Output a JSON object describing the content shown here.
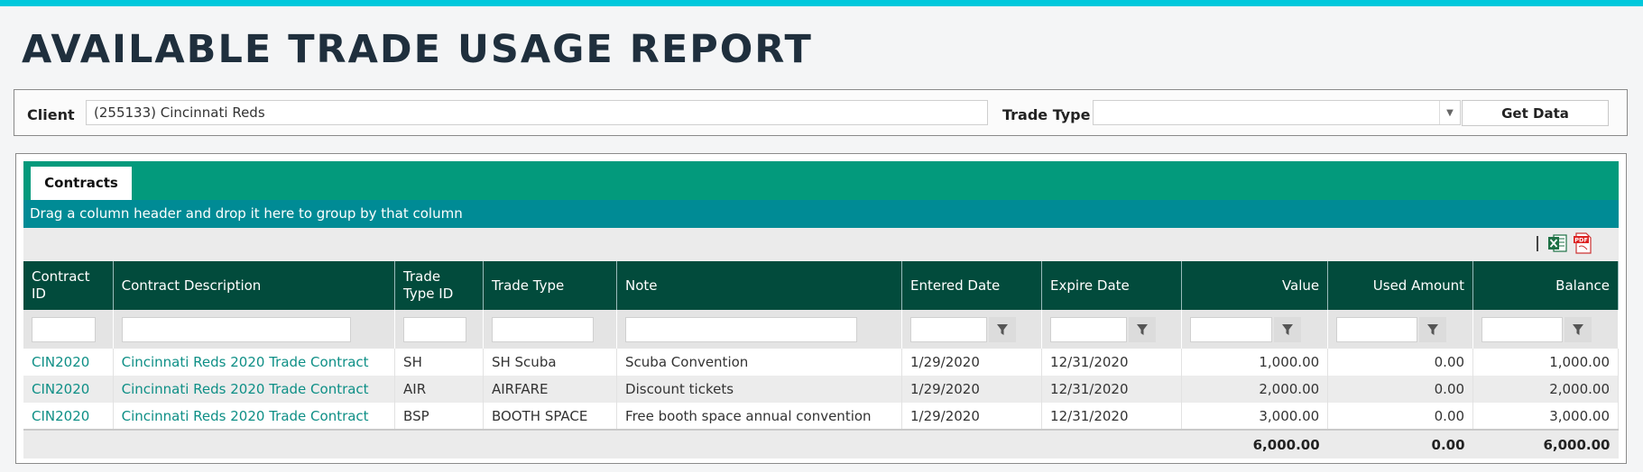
{
  "page_title": "AVAILABLE TRADE USAGE REPORT",
  "filters": {
    "client_label": "Client",
    "client_value": "(255133) Cincinnati Reds",
    "trade_type_label": "Trade Type",
    "trade_type_value": "",
    "get_data_label": "Get Data"
  },
  "tabs": [
    {
      "label": "Contracts",
      "active": true
    }
  ],
  "group_hint": "Drag a column header and drop it here to group by that column",
  "toolbar": {
    "export_excel_icon": "excel-icon",
    "export_pdf_icon": "pdf-icon"
  },
  "columns": [
    {
      "label": "Contract ID"
    },
    {
      "label": "Contract Description"
    },
    {
      "label": "Trade Type ID"
    },
    {
      "label": "Trade Type"
    },
    {
      "label": "Note"
    },
    {
      "label": "Entered Date"
    },
    {
      "label": "Expire Date"
    },
    {
      "label": "Value"
    },
    {
      "label": "Used Amount"
    },
    {
      "label": "Balance"
    }
  ],
  "rows": [
    {
      "contract_id": "CIN2020",
      "description": "Cincinnati Reds 2020 Trade Contract",
      "trade_type_id": "SH",
      "trade_type": "SH Scuba",
      "note": "Scuba Convention",
      "entered": "1/29/2020",
      "expire": "12/31/2020",
      "value": "1,000.00",
      "used": "0.00",
      "balance": "1,000.00"
    },
    {
      "contract_id": "CIN2020",
      "description": "Cincinnati Reds 2020 Trade Contract",
      "trade_type_id": "AIR",
      "trade_type": "AIRFARE",
      "note": "Discount tickets",
      "entered": "1/29/2020",
      "expire": "12/31/2020",
      "value": "2,000.00",
      "used": "0.00",
      "balance": "2,000.00"
    },
    {
      "contract_id": "CIN2020",
      "description": "Cincinnati Reds 2020 Trade Contract",
      "trade_type_id": "BSP",
      "trade_type": "BOOTH SPACE",
      "note": "Free booth space annual convention",
      "entered": "1/29/2020",
      "expire": "12/31/2020",
      "value": "3,000.00",
      "used": "0.00",
      "balance": "3,000.00"
    }
  ],
  "totals": {
    "value": "6,000.00",
    "used": "0.00",
    "balance": "6,000.00"
  },
  "colors": {
    "accent_bar": "#00c8dc",
    "tab_bar": "#039a7c",
    "group_bar": "#008b95",
    "header": "#024b3c",
    "link": "#0e8f86"
  }
}
